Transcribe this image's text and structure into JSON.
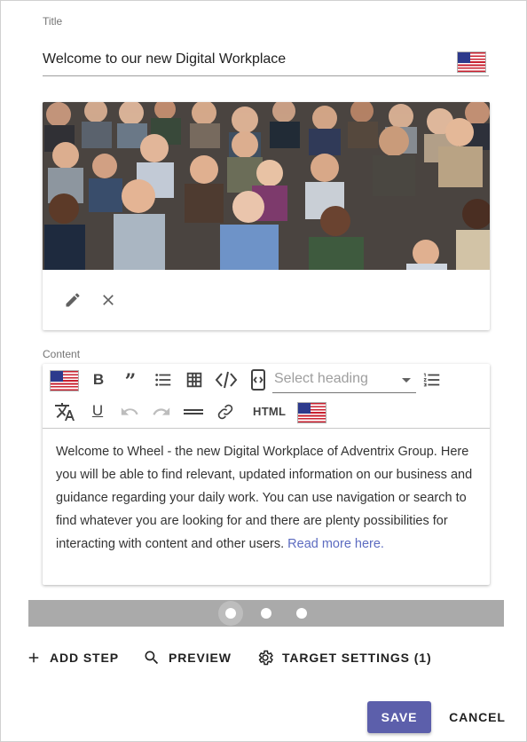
{
  "title_field": {
    "label": "Title",
    "value": "Welcome to our new Digital Workplace",
    "language_flag": "us-flag-icon"
  },
  "image_card": {
    "image_description_icon": "crowd-photo",
    "actions": [
      {
        "name": "edit",
        "icon": "pencil-icon"
      },
      {
        "name": "remove",
        "icon": "close-icon"
      }
    ]
  },
  "content": {
    "label": "Content",
    "toolbar": {
      "language_flag": "us-flag-icon",
      "bold_label": "B",
      "quote_label": "”",
      "heading_placeholder": "Select heading",
      "underline_label": "U",
      "html_label": "HTML",
      "icons": [
        "bulleted-list-icon",
        "table-icon",
        "code-icon",
        "source-icon",
        "numbered-list-icon",
        "translate-icon",
        "undo-icon",
        "redo-icon",
        "horizontal-line-icon",
        "link-icon"
      ]
    },
    "body_text": "Welcome to Wheel - the new Digital Workplace of Adventrix Group. Here you will be able to find relevant, updated information on our business and guidance regarding your daily work. You can use navigation or search to find whatever you are looking for and there are plenty possibilities for interacting with content and other users.",
    "link_text": "Read more here."
  },
  "stepper": {
    "steps": 3,
    "active_step": 1
  },
  "actions": {
    "add_step": "ADD STEP",
    "preview": "PREVIEW",
    "target_settings": "TARGET SETTINGS (1)"
  },
  "footer": {
    "save": "SAVE",
    "cancel": "CANCEL"
  },
  "colors": {
    "primary": "#5c5fab",
    "link": "#5c6bc0",
    "stepper_bg": "#aaaaaa"
  }
}
